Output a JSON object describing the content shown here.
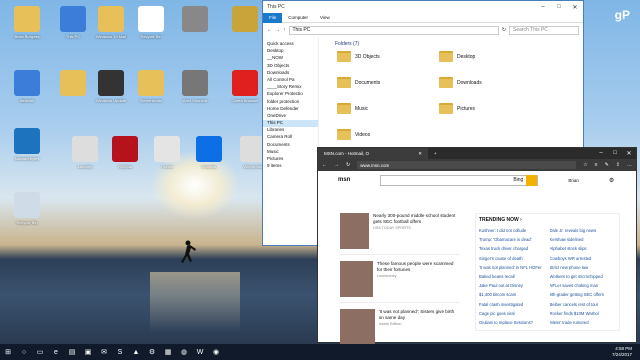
{
  "desktop": {
    "watermark": "gP",
    "icons": [
      {
        "label": "Brian Burgess",
        "icon": "user-folder-icon",
        "color": "#e8c05a"
      },
      {
        "label": "This PC",
        "icon": "computer-icon",
        "color": "#3b7dd8"
      },
      {
        "label": "Windows 10 Mail",
        "icon": "folder-icon",
        "color": "#e8c05a"
      },
      {
        "label": "Recycle Bin",
        "icon": "notepad-icon",
        "color": "#ffffff"
      },
      {
        "label": "",
        "icon": "mixer-icon",
        "color": "#888888"
      },
      {
        "label": "",
        "icon": "pineapple-icon",
        "color": "#c9a43a"
      },
      {
        "label": "Network",
        "icon": "network-icon",
        "color": "#3b7dd8"
      },
      {
        "label": "",
        "icon": "folder-icon",
        "color": "#e8c05a"
      },
      {
        "label": "Windows Update",
        "icon": "video-icon",
        "color": "#333333"
      },
      {
        "label": "Screenshots",
        "icon": "folder-icon",
        "color": "#e8c05a"
      },
      {
        "label": "Acer Shortcut",
        "icon": "package-icon",
        "color": "#777777"
      },
      {
        "label": "Opera Browser",
        "icon": "opera-icon",
        "color": "#e0201f"
      },
      {
        "label": "Malwarebytes",
        "icon": "malwarebytes-icon",
        "color": "#1e73be"
      },
      {
        "label": "Laundry",
        "icon": "document-icon",
        "color": "#dddddd"
      },
      {
        "label": "FileZilla",
        "icon": "filezilla-icon",
        "color": "#b5121b"
      },
      {
        "label": "iTunes",
        "icon": "itunes-icon",
        "color": "#e4e4e4"
      },
      {
        "label": "Dropbox",
        "icon": "dropbox-icon",
        "color": "#0d6fe6"
      },
      {
        "label": "WinDirStat",
        "icon": "document-icon",
        "color": "#dddddd"
      },
      {
        "label": "Recycle Bin",
        "icon": "recycle-bin-icon",
        "color": "#cfdbe6"
      }
    ]
  },
  "explorer": {
    "title": "This PC",
    "ribbon": [
      "File",
      "Computer",
      "View"
    ],
    "address": "This PC",
    "search_placeholder": "Search This PC",
    "nav": [
      "Quick access",
      "Desktop",
      "__NOW",
      "3D Objects",
      "Downloads",
      "All Control Pa",
      "____Story Remix",
      "Explorer Protectio",
      "folder protection",
      "Home Defender",
      "OneDrive",
      "This PC",
      "Libraries",
      "Camera Roll",
      "Documents",
      "Music",
      "Pictures",
      "9 items"
    ],
    "section": "Folders (7)",
    "folders": [
      "3D Objects",
      "Desktop",
      "Documents",
      "Downloads",
      "Music",
      "Pictures",
      "Videos"
    ]
  },
  "edge": {
    "tab_title": "MSN.com - Hotmail, O",
    "url": "www.msn.com",
    "logo": "msn",
    "search_button": "Bing",
    "user": "Brian",
    "stories": [
      {
        "title": "Nearly 300-pound middle school student gets SEC football offers",
        "source": "USA TODAY SPORTS"
      },
      {
        "title": "These famous people were scammed for their fortunes",
        "source": "Lovemoney"
      },
      {
        "title": "'It was not planned': Sisters give birth on same day",
        "source": "Inside Edition"
      }
    ],
    "trending_title": "TRENDING NOW ›",
    "trending": [
      [
        "Kushner: I did not collude",
        "Dale Jr. reveals big news"
      ],
      [
        "Trump: 'Obamacare is dead'",
        "Kershaw sidelined"
      ],
      [
        "Texas truck driver charged",
        "Alphabet stock slips"
      ],
      [
        "Singer's cause of death",
        "Cowboys WR arrested"
      ],
      [
        "'It was not planned' in NFL HOFer",
        "Strict new phone law"
      ],
      [
        "Baked beans recall",
        "Workers to get microchipped"
      ],
      [
        "Jake Paul out at Disney",
        "NFLer saves choking man"
      ],
      [
        "$1,400 bitcoin scam",
        "9th-grader getting SEC offers"
      ],
      [
        "Fatal crash investigated",
        "Beiber cancels rest of tour"
      ],
      [
        "Cage pic goes viral",
        "Rocker finds $10M Warhol"
      ],
      [
        "Giuliani to replace Sessions?",
        "'Mess' trade rumored"
      ]
    ]
  },
  "taskbar": {
    "time": "4:58 PM",
    "date": "7/24/2017"
  }
}
